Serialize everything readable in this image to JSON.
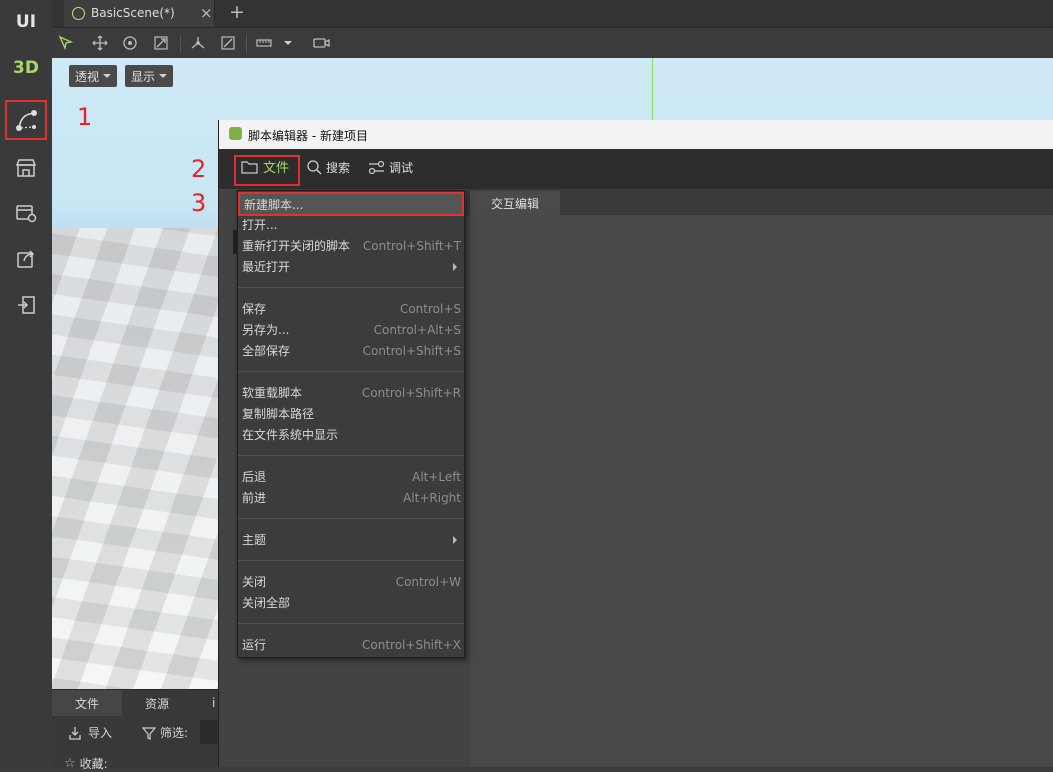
{
  "rail": {
    "ui_label": "UI",
    "threed_label": "3D"
  },
  "tabs": {
    "scene_tab": "BasicScene(*)",
    "close_glyph": "×",
    "add_glyph": "+"
  },
  "viewport": {
    "perspective_label": "透视",
    "display_label": "显示"
  },
  "bottom_panel": {
    "tab_files": "文件",
    "tab_assets": "资源",
    "tab_partial": "i",
    "import_label": "导入",
    "filter_label": "筛选:",
    "favorites_label": "收藏:"
  },
  "editor": {
    "title": "脚本编辑器 - 新建项目",
    "menu_file": "文件",
    "menu_search": "搜索",
    "menu_debug": "调试",
    "tab_interactive": "交互编辑"
  },
  "file_menu": {
    "new_script": "新建脚本...",
    "open": "打开...",
    "reopen_closed": "重新打开关闭的脚本",
    "reopen_closed_shortcut": "Control+Shift+T",
    "recent": "最近打开",
    "save": "保存",
    "save_shortcut": "Control+S",
    "save_as": "另存为...",
    "save_as_shortcut": "Control+Alt+S",
    "save_all": "全部保存",
    "save_all_shortcut": "Control+Shift+S",
    "soft_reload": "软重载脚本",
    "soft_reload_shortcut": "Control+Shift+R",
    "copy_path": "复制脚本路径",
    "show_in_fs": "在文件系统中显示",
    "back": "后退",
    "back_shortcut": "Alt+Left",
    "forward": "前进",
    "forward_shortcut": "Alt+Right",
    "theme": "主题",
    "close": "关闭",
    "close_shortcut": "Control+W",
    "close_all": "关闭全部",
    "run": "运行",
    "run_shortcut": "Control+Shift+X"
  },
  "annotations": {
    "step1": "1",
    "step2": "2",
    "step3": "3"
  },
  "colors": {
    "highlight": "#e03030",
    "accent_green": "#a8d66a"
  }
}
